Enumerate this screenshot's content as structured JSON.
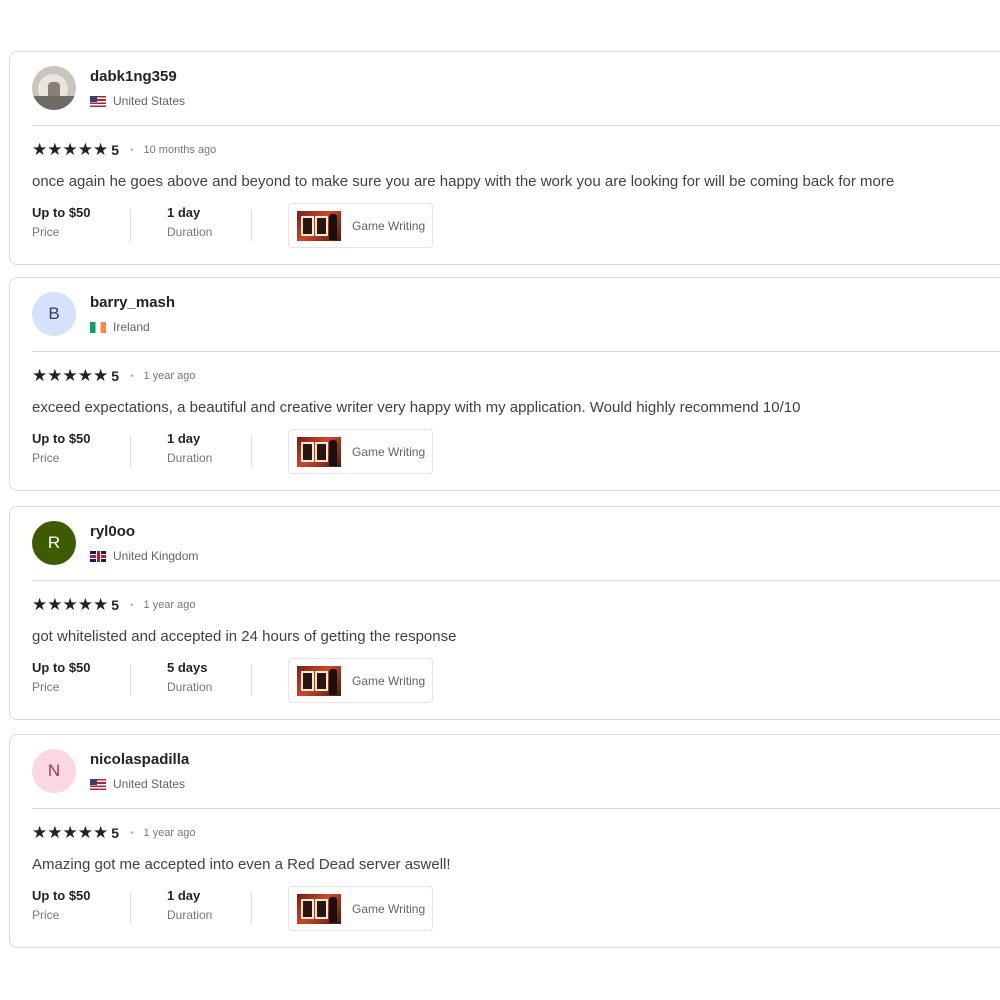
{
  "reviews": [
    {
      "username": "dabk1ng359",
      "country": "United States",
      "flag": "us",
      "avatar_type": "photo",
      "avatar_initial": "",
      "avatar_bg": "#c9c4bc",
      "avatar_fg": "#ffffff",
      "stars": "★★★★★",
      "rating": "5",
      "time_ago": "10 months ago",
      "text": "once again he goes above and beyond to make sure you are happy with the work you are looking for will be coming back for more",
      "price_value": "Up to $50",
      "price_label": "Price",
      "duration_value": "1 day",
      "duration_label": "Duration",
      "gig_title": "Game Writing"
    },
    {
      "username": "barry_mash",
      "country": "Ireland",
      "flag": "ie",
      "avatar_type": "initial",
      "avatar_initial": "B",
      "avatar_bg": "#d6e1fb",
      "avatar_fg": "#2a3f7a",
      "stars": "★★★★★",
      "rating": "5",
      "time_ago": "1 year ago",
      "text": "exceed expectations, a beautiful and creative writer very happy with my application. Would highly recommend 10/10",
      "price_value": "Up to $50",
      "price_label": "Price",
      "duration_value": "1 day",
      "duration_label": "Duration",
      "gig_title": "Game Writing"
    },
    {
      "username": "ryl0oo",
      "country": "United Kingdom",
      "flag": "uk",
      "avatar_type": "initial",
      "avatar_initial": "R",
      "avatar_bg": "#3e5b00",
      "avatar_fg": "#ffffff",
      "stars": "★★★★★",
      "rating": "5",
      "time_ago": "1 year ago",
      "text": "got whitelisted and accepted in 24 hours of getting the response",
      "price_value": "Up to $50",
      "price_label": "Price",
      "duration_value": "5 days",
      "duration_label": "Duration",
      "gig_title": "Game Writing"
    },
    {
      "username": "nicolaspadilla",
      "country": "United States",
      "flag": "us",
      "avatar_type": "initial",
      "avatar_initial": "N",
      "avatar_bg": "#fbd7e2",
      "avatar_fg": "#9b3a52",
      "stars": "★★★★★",
      "rating": "5",
      "time_ago": "1 year ago",
      "text": "Amazing got me accepted into even a Red Dead server aswell!",
      "price_value": "Up to $50",
      "price_label": "Price",
      "duration_value": "1 day",
      "duration_label": "Duration",
      "gig_title": "Game Writing"
    }
  ]
}
